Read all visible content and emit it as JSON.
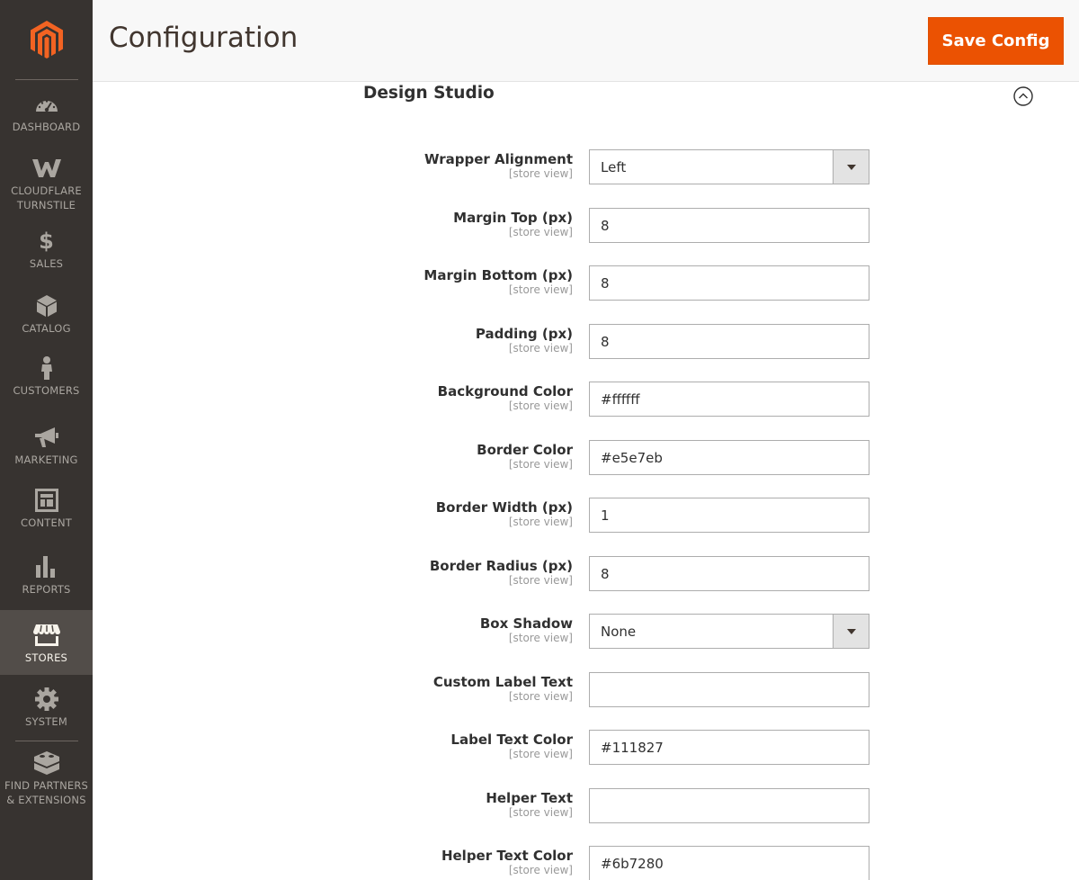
{
  "sidebar": {
    "items": [
      {
        "label": "DASHBOARD",
        "icon": "dashboard-icon"
      },
      {
        "label": "CLOUDFLARE TURNSTILE",
        "icon": "cloudflare-w-icon"
      },
      {
        "label": "SALES",
        "icon": "dollar-icon"
      },
      {
        "label": "CATALOG",
        "icon": "box-icon"
      },
      {
        "label": "CUSTOMERS",
        "icon": "person-icon"
      },
      {
        "label": "MARKETING",
        "icon": "megaphone-icon"
      },
      {
        "label": "CONTENT",
        "icon": "layout-icon"
      },
      {
        "label": "REPORTS",
        "icon": "bar-chart-icon"
      },
      {
        "label": "STORES",
        "icon": "store-icon",
        "active": true
      },
      {
        "label": "SYSTEM",
        "icon": "gear-icon"
      },
      {
        "label": "FIND PARTNERS & EXTENSIONS",
        "icon": "blocks-icon"
      }
    ]
  },
  "header": {
    "title": "Configuration",
    "save_label": "Save Config"
  },
  "section": {
    "title": "Design Studio"
  },
  "fields": [
    {
      "label": "Wrapper Alignment",
      "scope": "[store view]",
      "type": "select",
      "value": "Left"
    },
    {
      "label": "Margin Top (px)",
      "scope": "[store view]",
      "type": "text",
      "value": "8"
    },
    {
      "label": "Margin Bottom (px)",
      "scope": "[store view]",
      "type": "text",
      "value": "8"
    },
    {
      "label": "Padding (px)",
      "scope": "[store view]",
      "type": "text",
      "value": "8"
    },
    {
      "label": "Background Color",
      "scope": "[store view]",
      "type": "text",
      "value": "#ffffff"
    },
    {
      "label": "Border Color",
      "scope": "[store view]",
      "type": "text",
      "value": "#e5e7eb"
    },
    {
      "label": "Border Width (px)",
      "scope": "[store view]",
      "type": "text",
      "value": "1"
    },
    {
      "label": "Border Radius (px)",
      "scope": "[store view]",
      "type": "text",
      "value": "8"
    },
    {
      "label": "Box Shadow",
      "scope": "[store view]",
      "type": "select",
      "value": "None"
    },
    {
      "label": "Custom Label Text",
      "scope": "[store view]",
      "type": "text",
      "value": ""
    },
    {
      "label": "Label Text Color",
      "scope": "[store view]",
      "type": "text",
      "value": "#111827"
    },
    {
      "label": "Helper Text",
      "scope": "[store view]",
      "type": "text",
      "value": ""
    },
    {
      "label": "Helper Text Color",
      "scope": "[store view]",
      "type": "text",
      "value": "#6b7280"
    }
  ],
  "colors": {
    "sidebar_bg": "#373330",
    "sidebar_active": "#524d49",
    "accent": "#eb5202",
    "logo": "#f26322"
  }
}
